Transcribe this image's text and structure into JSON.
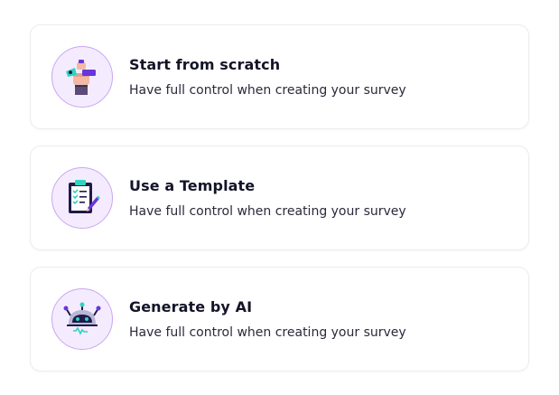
{
  "options": [
    {
      "title": "Start from scratch",
      "description": "Have full control when creating your survey",
      "icon": "hand-tools-icon"
    },
    {
      "title": "Use a Template",
      "description": "Have full control when creating your survey",
      "icon": "clipboard-checklist-icon"
    },
    {
      "title": "Generate by AI",
      "description": "Have full control when creating your survey",
      "icon": "robot-head-icon"
    }
  ],
  "colors": {
    "icon_background": "#f4ecfe",
    "icon_border": "#c9a6f2",
    "accent_purple": "#6a35d9",
    "accent_teal": "#2fd4c0",
    "navy": "#1e1b4b",
    "title_text": "#141428",
    "card_border": "#ececf0"
  }
}
